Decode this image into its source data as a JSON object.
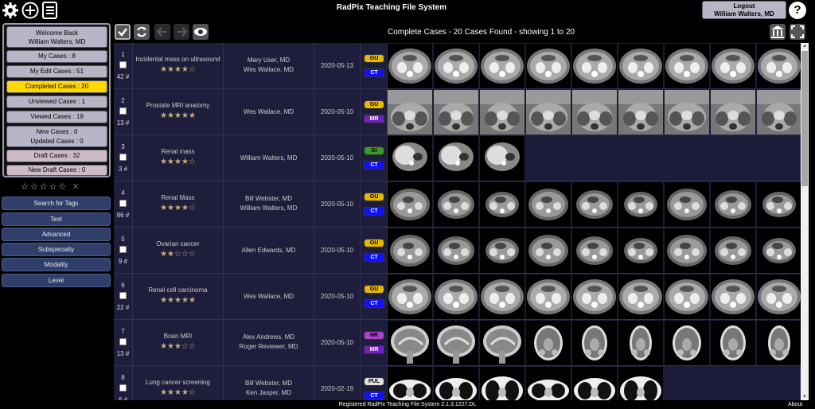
{
  "app": {
    "title": "RadPix Teaching File System",
    "footer": "Registered RadPix Teaching File System 2.1.3.1227.DL",
    "about": "About"
  },
  "logout": {
    "label": "Logout",
    "user": "William Walters, MD"
  },
  "help": {
    "label": "?"
  },
  "sidebar": {
    "welcome": "Welcome Back",
    "user": "William Walters, MD",
    "items": [
      {
        "label": "My Cases : 8"
      },
      {
        "label": "My Edit Cases : 51"
      },
      {
        "label": "Completed Cases : 20"
      },
      {
        "label": "Unviewed Cases : 1"
      },
      {
        "label": "Viewed Cases : 19"
      },
      {
        "label": "New Cases : 0"
      },
      {
        "label": "Updated Cases : 0"
      },
      {
        "label": "Draft Cases : 32"
      },
      {
        "label": "New Draft Cases : 0"
      }
    ],
    "stars": "☆☆☆☆☆",
    "clear": "✕",
    "filters": [
      {
        "label": "Search for Tags"
      },
      {
        "label": "Text"
      },
      {
        "label": "Advanced"
      },
      {
        "label": "Subspecialty"
      },
      {
        "label": "Modality"
      },
      {
        "label": "Level"
      }
    ]
  },
  "results": {
    "title": "Complete Cases - 20 Cases Found - showing 1 to 20"
  },
  "colors": {
    "accent_yellow": "#ffd800",
    "sidebar_btn": "#b6b6c6",
    "filter_btn": "#2f3f6a",
    "table_bg": "#1e1e3c",
    "tag_gu": "#e8b800",
    "tag_gi": "#3a9a2a",
    "tag_nr": "#b040d0",
    "tag_pul": "#e0e0e0",
    "mod_ct": "#1010ff",
    "mod_mr": "#7020c0"
  },
  "cases": [
    {
      "num": "1",
      "count": "42 #",
      "title": "Incidental mass on ultrasound",
      "rating": "★★★★☆",
      "users": [
        "Mary User, MD",
        "Wes Wallace, MD"
      ],
      "date": "2020-05-13",
      "tag": "GU",
      "tag_color": "#e8b800",
      "modality": "CT",
      "mod_color": "#1010ff",
      "images": 9,
      "style": "ct-abd"
    },
    {
      "num": "2",
      "count": "13 #",
      "title": "Prostate MRI anatomy",
      "rating": "★★★★★",
      "users": [
        "Wes Wallace, MD"
      ],
      "date": "2020-05-10",
      "tag": "GU",
      "tag_color": "#e8b800",
      "modality": "MR",
      "mod_color": "#7020c0",
      "images": 9,
      "style": "mr-pelvis"
    },
    {
      "num": "3",
      "count": "3 #",
      "title": "Renal mass",
      "rating": "★★★★☆",
      "users": [
        "William Walters, MD"
      ],
      "date": "2020-05-10",
      "tag": "GI",
      "tag_color": "#3a9a2a",
      "modality": "CT",
      "mod_color": "#1010ff",
      "images": 3,
      "style": "ct-liver"
    },
    {
      "num": "4",
      "count": "86 #",
      "title": "Renal Mass",
      "rating": "★★★★☆",
      "users": [
        "Bill Webster, MD",
        "William Walters, MD"
      ],
      "date": "2020-05-10",
      "tag": "GU",
      "tag_color": "#e8b800",
      "modality": "CT",
      "mod_color": "#1010ff",
      "images": 9,
      "style": "ct-abd2"
    },
    {
      "num": "5",
      "count": "9 #",
      "title": "Ovarian cancer",
      "rating": "★★☆☆☆",
      "users": [
        "Allen Edwards, MD"
      ],
      "date": "2020-05-10",
      "tag": "GU",
      "tag_color": "#e8b800",
      "modality": "CT",
      "mod_color": "#1010ff",
      "images": 9,
      "style": "ct-abd2"
    },
    {
      "num": "6",
      "count": "22 #",
      "title": "Renal cell carcinoma",
      "rating": "★★★★★",
      "users": [
        "Wes Wallace, MD"
      ],
      "date": "2020-05-10",
      "tag": "GU",
      "tag_color": "#e8b800",
      "modality": "CT",
      "mod_color": "#1010ff",
      "images": 9,
      "style": "ct-abd"
    },
    {
      "num": "7",
      "count": "13 #",
      "title": "Brain MRI",
      "rating": "★★★☆☆",
      "users": [
        "Alex Andrews, MD",
        "Roger Reviewer, MD"
      ],
      "date": "2020-05-10",
      "tag": "NR",
      "tag_color": "#b040d0",
      "modality": "MR",
      "mod_color": "#7020c0",
      "images": 9,
      "style": "mr-brain"
    },
    {
      "num": "8",
      "count": "6 #",
      "title": "Lung cancer screening",
      "rating": "★★★★☆",
      "users": [
        "Bill Webster, MD",
        "Ken Jasper, MD"
      ],
      "date": "2020-02-19",
      "tag": "PUL",
      "tag_color": "#e0e0e0",
      "modality": "CT",
      "mod_color": "#1010ff",
      "images": 6,
      "style": "ct-chest"
    }
  ]
}
